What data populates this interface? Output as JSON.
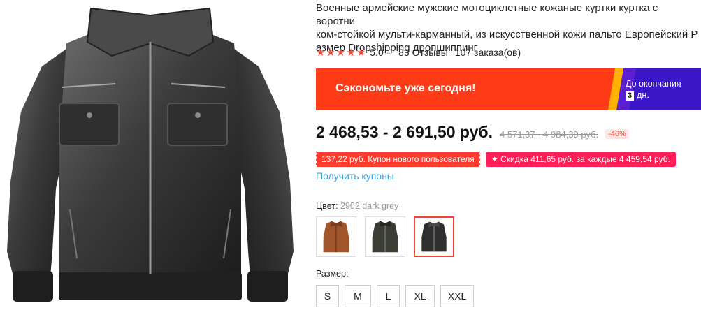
{
  "product": {
    "title": "Военные армейские мужские мотоциклетные кожаные куртки куртка с воротником-стойкой мульти-карманный, из искусственной кожи пальто Европейский Размер Dropshipping дропшиппинг",
    "title_line1": "Военные армейские мужские мотоциклетные кожаные куртки куртка с воротни",
    "title_line2": "ком-стойкой мульти-карманный, из искусственной кожи пальто Европейский Р",
    "title_line3": "азмер Dropshipping дропшиппинг"
  },
  "rating": {
    "stars": 5,
    "score": "5.0",
    "reviews": "83 Отзывы",
    "orders": "107 заказа(ов)",
    "star_color": "#f44336"
  },
  "banner": {
    "text": "Сэкономьте уже сегодня!",
    "countdown_line1": "До окончания",
    "countdown_days": "3",
    "countdown_suffix": "дн.",
    "bg_color": "#ff3c17"
  },
  "price": {
    "current": "2 468,53 - 2 691,50 руб.",
    "old": "4 571,37 - 4 984,39 руб.",
    "discount": "-46%"
  },
  "coupons": {
    "new_user": "137,22 руб. Купон нового пользователя",
    "discount": "✦ Скидка 411,65 руб. за каждые 4 459,54 руб.",
    "get_link": "Получить купоны"
  },
  "color": {
    "label": "Цвет:",
    "selected_value": "2902 dark grey",
    "options": [
      {
        "name": "brown",
        "color": "#a0562a"
      },
      {
        "name": "dark green",
        "color": "#3a3d33"
      },
      {
        "name": "dark grey",
        "color": "#2e2e2e"
      }
    ]
  },
  "size": {
    "label": "Размер:",
    "options": [
      "S",
      "M",
      "L",
      "XL",
      "XXL"
    ]
  }
}
